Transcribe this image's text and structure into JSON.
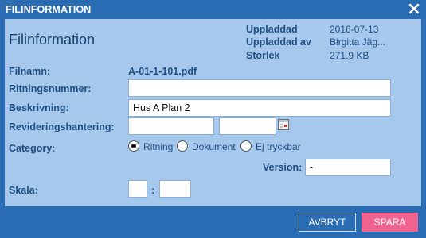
{
  "dialog": {
    "title": "FILINFORMATION",
    "close_icon": "close-icon",
    "heading": "Filinformation"
  },
  "meta": {
    "uploaded_label": "Uppladdad",
    "uploaded_value": "2016-07-13",
    "uploaded_by_label": "Uppladdad av",
    "uploaded_by_value": "Birgitta Jäg...",
    "size_label": "Storlek",
    "size_value": "271.9 KB"
  },
  "form": {
    "filename_label": "Filnamn:",
    "filename_value": "A-01-1-101.pdf",
    "drawing_number_label": "Ritningsnummer:",
    "drawing_number_value": "",
    "description_label": "Beskrivning:",
    "description_value": "Hus A Plan 2",
    "revision_label": "Revideringshantering:",
    "revision_value": "",
    "revision_date_value": "",
    "calendar_icon": "calendar-icon",
    "category_label": "Category:",
    "category_options": [
      "Ritning",
      "Dokument",
      "Ej tryckbar"
    ],
    "category_selected": "Ritning",
    "version_label": "Version:",
    "version_value": "-",
    "scale_label": "Skala:",
    "scale_left_value": "",
    "scale_separator": ":",
    "scale_right_value": ""
  },
  "buttons": {
    "cancel_label": "AVBRYT",
    "save_label": "SPARA"
  },
  "colors": {
    "header_blue": "#2a6db5",
    "panel_blue": "#a6c8ec",
    "label_blue": "#1f4f82",
    "save_pink": "#f1648f"
  }
}
